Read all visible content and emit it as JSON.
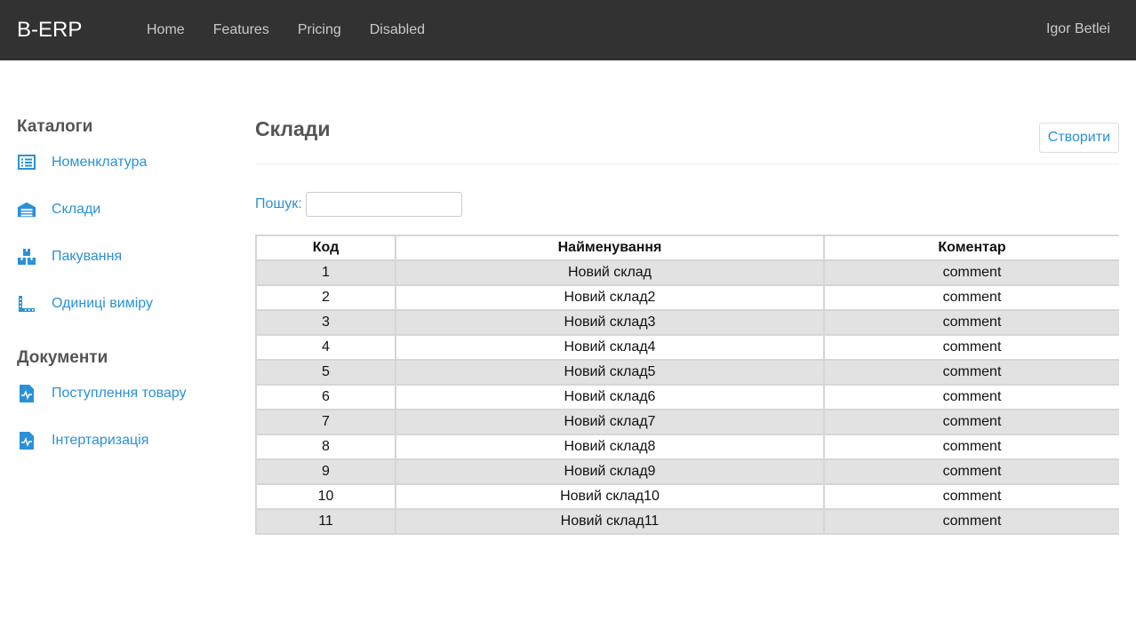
{
  "navbar": {
    "brand": "B-ERP",
    "links": [
      "Home",
      "Features",
      "Pricing",
      "Disabled"
    ],
    "user": "Igor Betlei"
  },
  "sidebar": {
    "catalogs_heading": "Каталоги",
    "catalogs": [
      {
        "label": "Номенклатура",
        "icon": "list-icon"
      },
      {
        "label": "Склади",
        "icon": "warehouse-icon"
      },
      {
        "label": "Пакування",
        "icon": "boxes-icon"
      },
      {
        "label": "Одиниці виміру",
        "icon": "ruler-icon"
      }
    ],
    "documents_heading": "Документи",
    "documents": [
      {
        "label": "Поступлення товару",
        "icon": "document-chart-icon"
      },
      {
        "label": "Інтертаризація",
        "icon": "document-chart-icon"
      }
    ]
  },
  "main": {
    "title": "Склади",
    "create_label": "Створити",
    "search_label": "Пошук:",
    "search_value": "",
    "table": {
      "headers": [
        "Код",
        "Найменування",
        "Коментар"
      ],
      "rows": [
        [
          "1",
          "Новий склад",
          "comment"
        ],
        [
          "2",
          "Новий склад2",
          "comment"
        ],
        [
          "3",
          "Новий склад3",
          "comment"
        ],
        [
          "4",
          "Новий склад4",
          "comment"
        ],
        [
          "5",
          "Новий склад5",
          "comment"
        ],
        [
          "6",
          "Новий склад6",
          "comment"
        ],
        [
          "7",
          "Новий склад7",
          "comment"
        ],
        [
          "8",
          "Новий склад8",
          "comment"
        ],
        [
          "9",
          "Новий склад9",
          "comment"
        ],
        [
          "10",
          "Новий склад10",
          "comment"
        ],
        [
          "11",
          "Новий склад11",
          "comment"
        ]
      ]
    }
  },
  "colors": {
    "navbar": "#333233",
    "accent": "#2a91d6",
    "row_alt": "#e2e2e2"
  }
}
